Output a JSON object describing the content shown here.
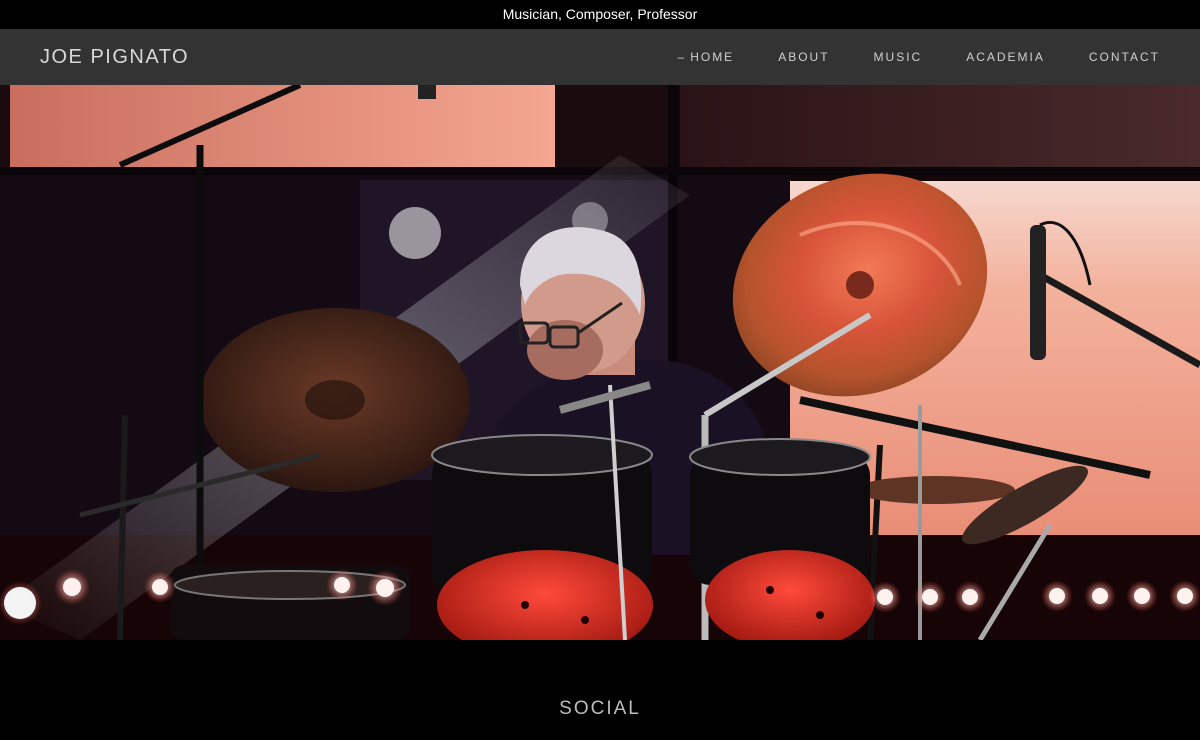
{
  "announcement": {
    "text": "Musician, Composer, Professor"
  },
  "header": {
    "site_title": "JOE PIGNATO",
    "nav": [
      {
        "label": "HOME",
        "active": true
      },
      {
        "label": "ABOUT",
        "active": false
      },
      {
        "label": "MUSIC",
        "active": false
      },
      {
        "label": "ACADEMIA",
        "active": false
      },
      {
        "label": "CONTACT",
        "active": false
      }
    ],
    "active_marker": "–"
  },
  "hero": {
    "subject": "drummer-performing-photo"
  },
  "social": {
    "heading": "SOCIAL"
  },
  "colors": {
    "header_bg": "#333333",
    "page_bg": "#000000",
    "stage_red": "#e0402f",
    "screen_pink": "#f2a88e"
  }
}
